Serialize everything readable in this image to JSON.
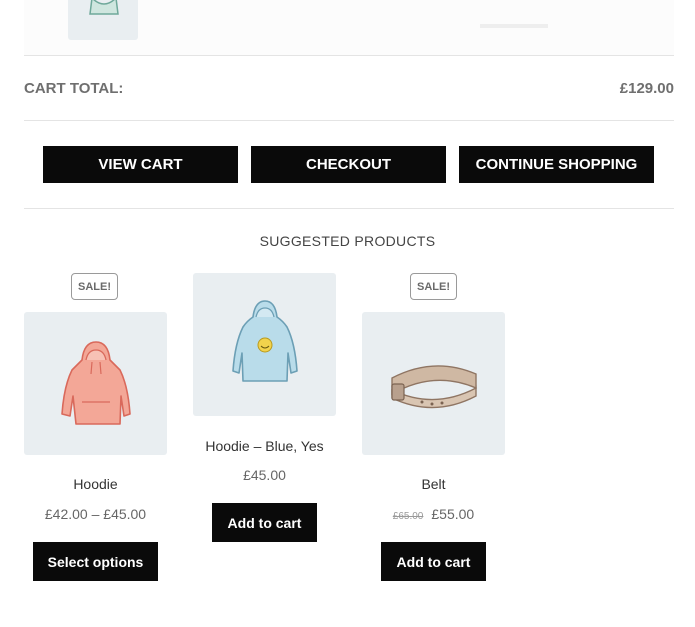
{
  "cart": {
    "total_label": "CART TOTAL:",
    "total_value": "£129.00"
  },
  "actions": {
    "view_cart": "VIEW CART",
    "checkout": "CHECKOUT",
    "continue_shopping": "CONTINUE SHOPPING"
  },
  "suggested": {
    "title": "SUGGESTED PRODUCTS",
    "products": [
      {
        "name": "Hoodie",
        "price": "£42.00 – £45.00",
        "badge": "SALE!",
        "button": "Select options",
        "icon": "hoodie-pink-icon"
      },
      {
        "name": "Hoodie – Blue, Yes",
        "price": "£45.00",
        "button": "Add to cart",
        "icon": "hoodie-blue-logo-icon"
      },
      {
        "name": "Belt",
        "old_price": "£65.00",
        "price": "£55.00",
        "badge": "SALE!",
        "button": "Add to cart",
        "icon": "belt-icon"
      }
    ]
  },
  "colors": {
    "button_bg": "#0a0a0a",
    "image_bg": "#e9eef1",
    "hoodie_pink": "#f3a797",
    "hoodie_blue": "#b9dcea",
    "belt_tan": "#cfb8a3"
  }
}
